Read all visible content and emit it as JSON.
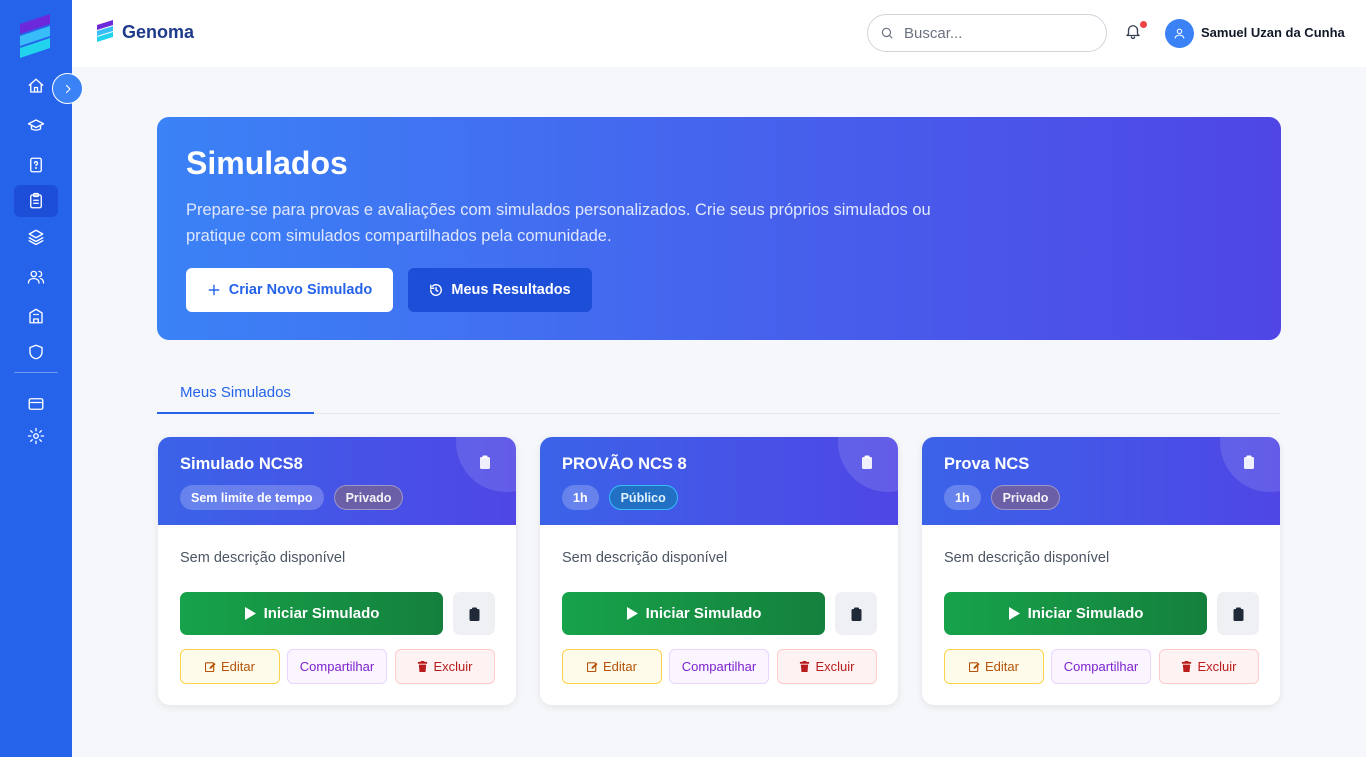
{
  "app": {
    "name": "Genoma"
  },
  "sidebar": {
    "items": [
      {
        "icon": "home-icon"
      },
      {
        "icon": "graduation-cap-icon"
      },
      {
        "icon": "question-file-icon"
      },
      {
        "icon": "clipboard-list-icon",
        "active": true
      },
      {
        "icon": "layers-icon"
      },
      {
        "icon": "users-icon"
      },
      {
        "icon": "building-icon"
      },
      {
        "icon": "shield-icon"
      },
      {
        "icon": "credit-card-icon"
      },
      {
        "icon": "settings-icon"
      }
    ]
  },
  "header": {
    "search_placeholder": "Buscar...",
    "user_name": "Samuel Uzan da Cunha"
  },
  "hero": {
    "title": "Simulados",
    "description": "Prepare-se para provas e avaliações com simulados personalizados. Crie seus próprios simulados ou pratique com simulados compartilhados pela comunidade.",
    "create_label": "Criar Novo Simulado",
    "results_label": "Meus Resultados"
  },
  "tabs": [
    {
      "label": "Meus Simulados",
      "active": true
    }
  ],
  "cards": [
    {
      "title": "Simulado NCS8",
      "time": "Sem limite de tempo",
      "visibility": "Privado",
      "description": "Sem descrição disponível",
      "start_label": "Iniciar Simulado",
      "edit_label": "Editar",
      "share_label": "Compartilhar",
      "delete_label": "Excluir"
    },
    {
      "title": "PROVÃO NCS 8",
      "time": "1h",
      "visibility": "Público",
      "description": "Sem descrição disponível",
      "start_label": "Iniciar Simulado",
      "edit_label": "Editar",
      "share_label": "Compartilhar",
      "delete_label": "Excluir"
    },
    {
      "title": "Prova NCS",
      "time": "1h",
      "visibility": "Privado",
      "description": "Sem descrição disponível",
      "start_label": "Iniciar Simulado",
      "edit_label": "Editar",
      "share_label": "Compartilhar",
      "delete_label": "Excluir"
    }
  ],
  "colors": {
    "sidebar": "#2563eb",
    "accent": "#2563eb",
    "start_button": "#16a34a",
    "edit": "#b45309",
    "share": "#7e22ce",
    "delete": "#b91c1c"
  }
}
